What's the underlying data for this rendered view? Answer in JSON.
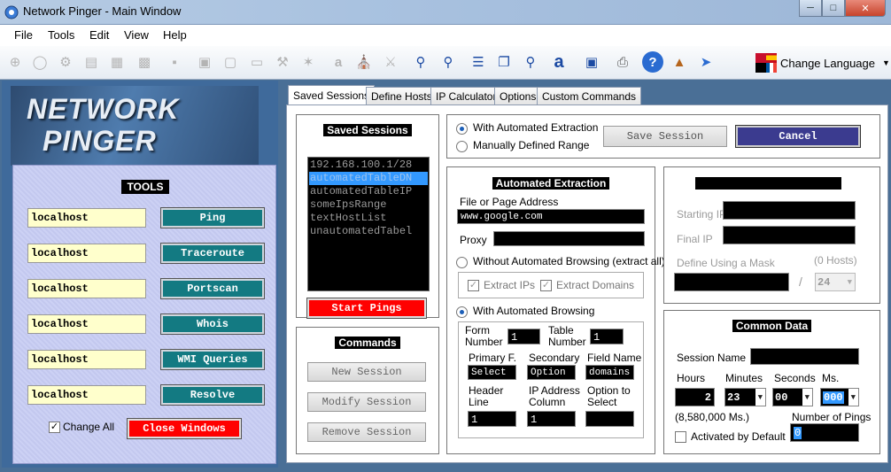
{
  "window": {
    "title": "Network Pinger - Main Window"
  },
  "menu": [
    "File",
    "Tools",
    "Edit",
    "View",
    "Help"
  ],
  "toolbar": {
    "language_label": "Change Language",
    "icons": [
      "target-icon",
      "globe-search-icon",
      "gear-network-icon",
      "document-icon",
      "grid-icon",
      "wmi-icon",
      "packet-icon",
      "network-card-icon",
      "monitor-icon",
      "monitor-screen-icon",
      "wrench-icon",
      "satellite-icon",
      "a-letter-icon",
      "bank-icon",
      "tools-icon",
      "search-icon",
      "search-wifi-icon",
      "database-icon",
      "copy-icon",
      "search-page-icon",
      "text-a-icon",
      "save-icon",
      "print-icon",
      "help-icon",
      "dynamite-icon",
      "exit-door-icon"
    ]
  },
  "left": {
    "logo_line1": "NETWORK",
    "logo_line2": "PINGER",
    "tools_title": "TOOLS",
    "tools": [
      {
        "host": "localhost",
        "label": "Ping"
      },
      {
        "host": "localhost",
        "label": "Traceroute"
      },
      {
        "host": "localhost",
        "label": "Portscan"
      },
      {
        "host": "localhost",
        "label": "Whois"
      },
      {
        "host": "localhost",
        "label": "WMI Queries"
      },
      {
        "host": "localhost",
        "label": "Resolve"
      }
    ],
    "change_all_label": "Change All",
    "close_windows_label": "Close Windows"
  },
  "tabs": [
    "Saved Sessions",
    "Define Hosts",
    "IP Calculator",
    "Options",
    "Custom Commands"
  ],
  "saved_sessions": {
    "title": "Saved Sessions",
    "items": [
      "192.168.100.1/28",
      "automatedTableDN",
      "automatedTableIP",
      "someIpsRange",
      "textHostList",
      "unautomatedTabel"
    ],
    "selected_index": 1,
    "start_pings_label": "Start Pings"
  },
  "commands": {
    "title": "Commands",
    "new_label": "New Session",
    "modify_label": "Modify Session",
    "remove_label": "Remove Session"
  },
  "mode": {
    "automated_label": "With Automated Extraction",
    "manual_label": "Manually Defined Range",
    "save_label": "Save Session",
    "cancel_label": "Cancel"
  },
  "extraction": {
    "title": "Automated Extraction",
    "file_label": "File or Page Address",
    "file_value": "www.google.com",
    "proxy_label": "Proxy",
    "without_label": "Without Automated Browsing (extract all)",
    "extract_ips_label": "Extract IPs",
    "extract_domains_label": "Extract Domains",
    "with_label": "With Automated Browsing",
    "form_number_label": "Form Number",
    "form_number_value": "1",
    "table_number_label": "Table Number",
    "table_number_value": "1",
    "primary_label": "Primary F.",
    "primary_value": "Select",
    "secondary_label": "Secondary",
    "secondary_value": "Option",
    "field_name_label": "Field Name",
    "field_name_value": "domains",
    "header_label": "Header Line",
    "header_value": "1",
    "ip_col_label": "IP Address Column",
    "ip_col_value": "1",
    "option_label": "Option to Select",
    "option_value": ""
  },
  "range": {
    "starting_label": "Starting IP",
    "final_label": "Final IP",
    "mask_label": "Define Using a Mask",
    "hosts_label": "(0 Hosts)",
    "slash": "/",
    "mask_value": "24"
  },
  "common": {
    "title": "Common Data",
    "session_name_label": "Session Name",
    "hours_label": "Hours",
    "minutes_label": "Minutes",
    "seconds_label": "Seconds",
    "ms_label": "Ms.",
    "hours_value": "2",
    "minutes_value": "23",
    "seconds_value": "00",
    "ms_value": "000",
    "total_ms": "(8,580,000 Ms.)",
    "num_pings_label": "Number of Pings",
    "num_pings_value": "0",
    "activated_label": "Activated by Default"
  },
  "colors": {
    "accent_teal": "#137a82",
    "red": "#ff0000",
    "cancel": "#3b3b8f",
    "selection": "#3399ff"
  }
}
